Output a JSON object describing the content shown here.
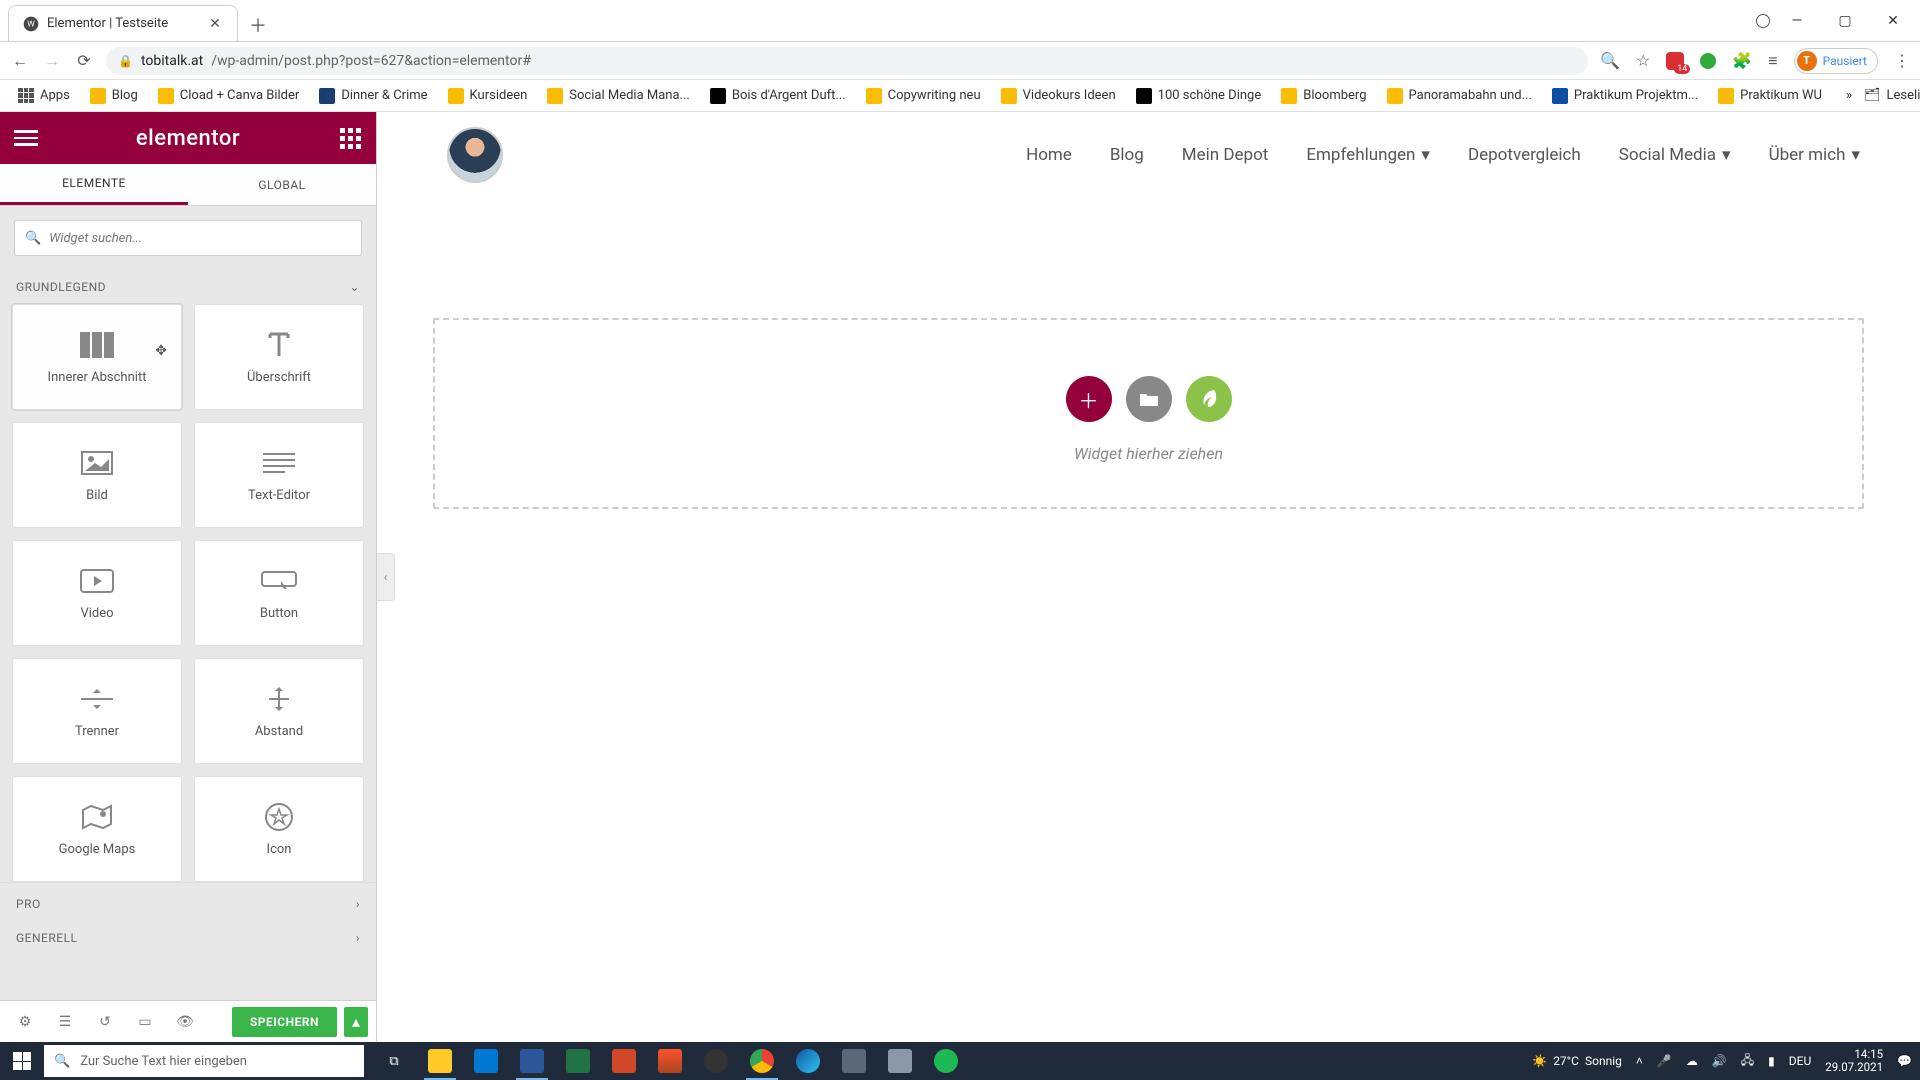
{
  "browser": {
    "tab_title": "Elementor | Testseite",
    "url_host": "tobitalk.at",
    "url_path": "/wp-admin/post.php?post=627&action=elementor#",
    "profile_status": "Pausiert",
    "profile_initial": "T",
    "ext_badge": "14",
    "bookmarks": [
      {
        "label": "Apps",
        "type": "grid"
      },
      {
        "label": "Blog",
        "type": "y"
      },
      {
        "label": "Cload + Canva Bilder",
        "type": "y"
      },
      {
        "label": "Dinner & Crime",
        "type": "b"
      },
      {
        "label": "Kursideen",
        "type": "y"
      },
      {
        "label": "Social Media Mana...",
        "type": "y"
      },
      {
        "label": "Bois d'Argent Duft...",
        "type": "k"
      },
      {
        "label": "Copywriting neu",
        "type": "y"
      },
      {
        "label": "Videokurs Ideen",
        "type": "y"
      },
      {
        "label": "100 schöne Dinge",
        "type": "k"
      },
      {
        "label": "Bloomberg",
        "type": "y"
      },
      {
        "label": "Panoramabahn und...",
        "type": "y"
      },
      {
        "label": "Praktikum Projektm...",
        "type": "p"
      },
      {
        "label": "Praktikum WU",
        "type": "y"
      }
    ],
    "readlist": "Leseliste"
  },
  "sidebar": {
    "logo": "elementor",
    "tabs": {
      "elements": "ELEMENTE",
      "global": "GLOBAL"
    },
    "search_placeholder": "Widget suchen...",
    "cat_basic": "GRUNDLEGEND",
    "cat_pro": "PRO",
    "cat_general": "GENERELL",
    "widgets": [
      {
        "id": "inner-section",
        "label": "Innerer Abschnitt"
      },
      {
        "id": "heading",
        "label": "Überschrift"
      },
      {
        "id": "image",
        "label": "Bild"
      },
      {
        "id": "text-editor",
        "label": "Text-Editor"
      },
      {
        "id": "video",
        "label": "Video"
      },
      {
        "id": "button",
        "label": "Button"
      },
      {
        "id": "divider",
        "label": "Trenner"
      },
      {
        "id": "spacer",
        "label": "Abstand"
      },
      {
        "id": "google-maps",
        "label": "Google Maps"
      },
      {
        "id": "icon",
        "label": "Icon"
      }
    ],
    "save": "SPEICHERN"
  },
  "preview": {
    "nav": [
      {
        "label": "Home"
      },
      {
        "label": "Blog"
      },
      {
        "label": "Mein Depot"
      },
      {
        "label": "Empfehlungen",
        "dd": true
      },
      {
        "label": "Depotvergleich"
      },
      {
        "label": "Social Media",
        "dd": true
      },
      {
        "label": "Über mich",
        "dd": true
      }
    ],
    "dropzone_text": "Widget hierher ziehen"
  },
  "taskbar": {
    "search_placeholder": "Zur Suche Text hier eingeben",
    "weather_temp": "27°C",
    "weather_text": "Sonnig",
    "lang": "DEU",
    "time": "14:15",
    "date": "29.07.2021"
  }
}
